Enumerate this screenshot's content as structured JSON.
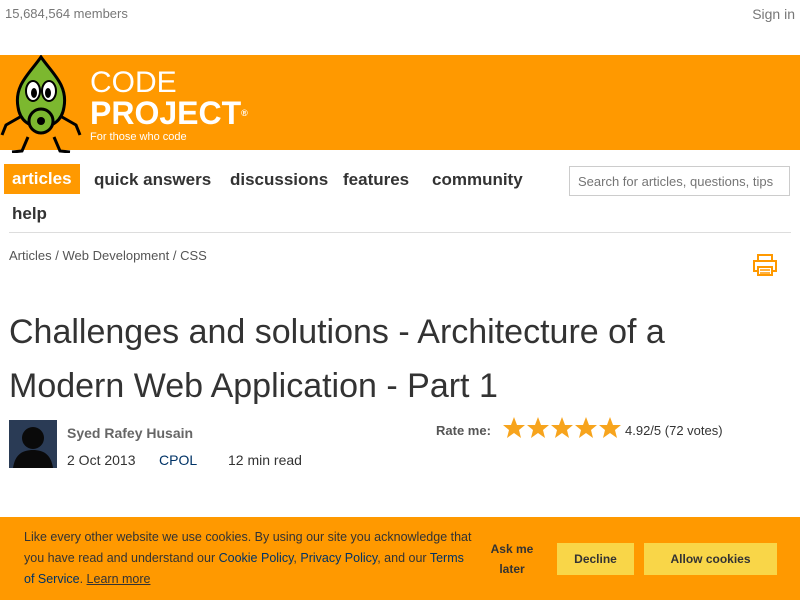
{
  "header": {
    "members": "15,684,564 members",
    "signin": "Sign in"
  },
  "logo": {
    "line1": "CODE",
    "line2": "PROJECT",
    "registered": "®",
    "tagline": "For those who code"
  },
  "nav": {
    "items": [
      "articles",
      "quick answers",
      "discussions",
      "features",
      "community",
      "help"
    ],
    "active": "articles"
  },
  "search": {
    "placeholder": "Search for articles, questions, tips"
  },
  "breadcrumb": {
    "items": [
      "Articles",
      "Web Development",
      "CSS"
    ],
    "separator": "/"
  },
  "article": {
    "title": "Challenges and solutions - Architecture of a Modern Web Application - Part 1",
    "author": "Syed Rafey Husain",
    "date": "2 Oct 2013",
    "license": "CPOL",
    "read_time": "12 min read",
    "rate_label": "Rate me:",
    "rating": "4.92/5 (72 votes)",
    "stars": 5
  },
  "cookie": {
    "text_before": "Like every other website we use cookies. By using our site you acknowledge that you have read and understand our ",
    "cookie_policy": "Cookie Policy",
    "sep1": ", ",
    "privacy_policy": "Privacy Policy",
    "sep2": ", and our ",
    "terms": "Terms of Service",
    "sep3": ". ",
    "learn_more": "Learn more",
    "ask_later": "Ask me later",
    "decline": "Decline",
    "allow": "Allow cookies"
  },
  "colors": {
    "brand_orange": "#ff9900",
    "button_yellow": "#f9d648",
    "star_orange": "#f7a41d"
  }
}
